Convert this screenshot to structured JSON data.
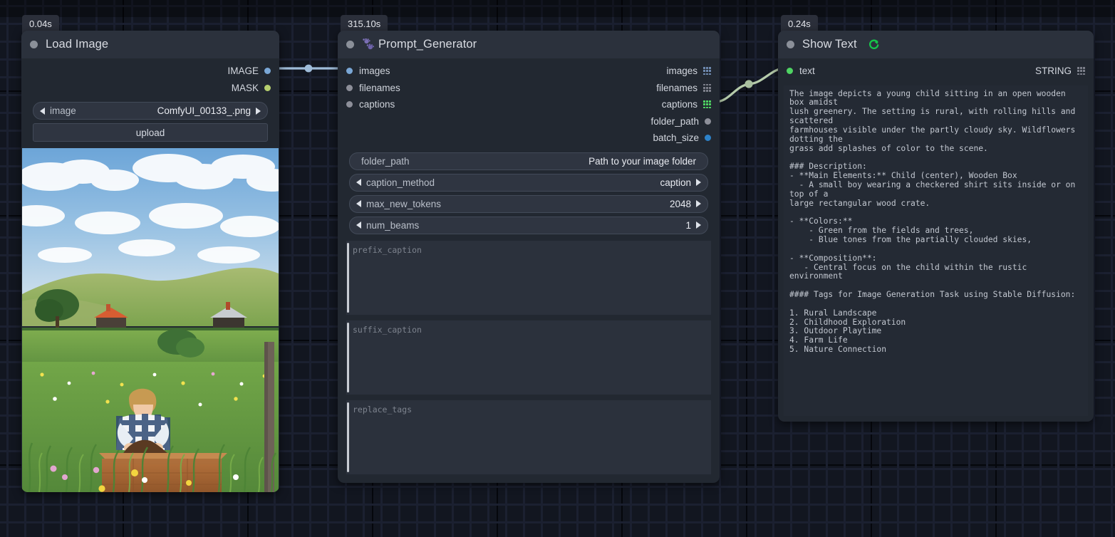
{
  "canvas": {
    "background_color": "#121620",
    "grid_line_color": "#05070c"
  },
  "nodes": [
    {
      "id": "load-image",
      "title": "Load Image",
      "exec_time": "0.04s",
      "outputs": [
        {
          "label": "IMAGE",
          "color": "#7aa7d6"
        },
        {
          "label": "MASK",
          "color": "#b6cf6e"
        }
      ],
      "widgets": [
        {
          "name": "image",
          "value": "ComfyUI_00133_.png",
          "type": "combo"
        },
        {
          "name": "upload",
          "value": "upload",
          "type": "button"
        }
      ],
      "image_alt": "Young child in a blue checkered shirt playing with soil in a large wooden crate in a flowering meadow, rolling green hills and farmhouses under a partly cloudy sky"
    },
    {
      "id": "prompt-generator",
      "title": "Prompt_Generator",
      "exec_time": "315.10s",
      "icon": "paw-prints-icon",
      "inputs": [
        {
          "label": "images",
          "color": "#7aa7d6"
        },
        {
          "label": "filenames",
          "color": "#8d8f99"
        },
        {
          "label": "captions",
          "color": "#8d8f99"
        }
      ],
      "outputs": [
        {
          "label": "images",
          "icon": "grid-icon",
          "color": "#6f8ab0"
        },
        {
          "label": "filenames",
          "icon": "grid-icon",
          "color": "#8d8f99"
        },
        {
          "label": "captions",
          "icon": "grid-icon",
          "color": "#4fd463"
        },
        {
          "label": "folder_path",
          "icon": "dot",
          "color": "#8d8f99"
        },
        {
          "label": "batch_size",
          "icon": "dot",
          "color": "#2d82c9"
        }
      ],
      "widgets": [
        {
          "name": "folder_path",
          "value": "Path to your image folder",
          "type": "text"
        },
        {
          "name": "caption_method",
          "value": "caption",
          "type": "combo"
        },
        {
          "name": "max_new_tokens",
          "value": "2048",
          "type": "number"
        },
        {
          "name": "num_beams",
          "value": "1",
          "type": "number"
        }
      ],
      "textareas": [
        {
          "placeholder": "prefix_caption",
          "value": ""
        },
        {
          "placeholder": "suffix_caption",
          "value": ""
        },
        {
          "placeholder": "replace_tags",
          "value": ""
        }
      ]
    },
    {
      "id": "show-text",
      "title": "Show Text",
      "exec_time": "0.24s",
      "icon": "refresh-icon",
      "inputs": [
        {
          "label": "text",
          "color": "#4fd463"
        }
      ],
      "outputs": [
        {
          "label": "STRING",
          "icon": "grid-icon",
          "color": "#8d8f99"
        }
      ],
      "text_output": "The image depicts a young child sitting in an open wooden box amidst\nlush greenery. The setting is rural, with rolling hills and scattered\nfarmhouses visible under the partly cloudy sky. Wildflowers dotting the\ngrass add splashes of color to the scene.\n\n### Description:\n- **Main Elements:** Child (center), Wooden Box\n  - A small boy wearing a checkered shirt sits inside or on top of a\nlarge rectangular wood crate.\n\n- **Colors:**\n    - Green from the fields and trees,\n    - Blue tones from the partially clouded skies,\n\n- **Composition**:\n   - Central focus on the child within the rustic environment\n\n#### Tags for Image Generation Task using Stable Diffusion:\n\n1. Rural Landscape\n2. Childhood Exploration\n3. Outdoor Playtime\n4. Farm Life\n5. Nature Connection"
    }
  ],
  "links": [
    {
      "from": "IMAGE",
      "to": "images",
      "color": "#9fbcd9"
    },
    {
      "from": "captions",
      "to": "text",
      "color": "#b6ccab"
    }
  ]
}
